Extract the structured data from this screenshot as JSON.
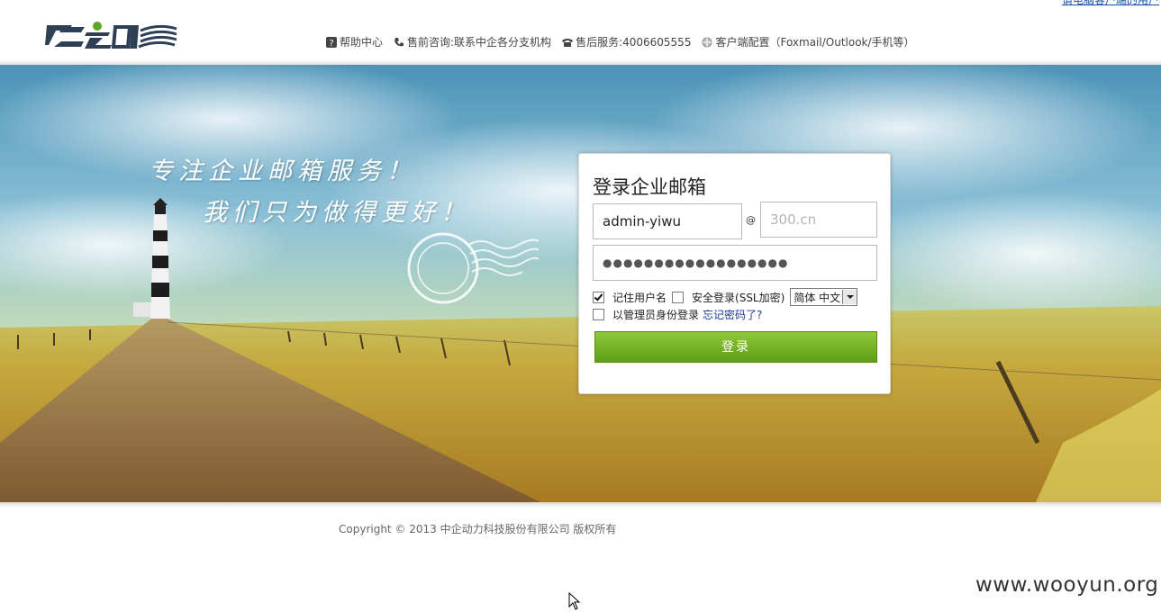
{
  "header": {
    "top_link": "请电脑客户端的用户",
    "logo_alt": "Z云邮",
    "nav": [
      {
        "icon": "question-icon",
        "label": "帮助中心"
      },
      {
        "icon": "phone-icon",
        "label": "售前咨询:联系中企各分支机构"
      },
      {
        "icon": "telephone-icon",
        "label": "售后服务:4006605555"
      },
      {
        "icon": "globe-icon",
        "label": "客户端配置（Foxmail/Outlook/手机等）"
      }
    ]
  },
  "banner": {
    "slogan_line1": "专注企业邮箱服务！",
    "slogan_line2": "我们只为做得更好！"
  },
  "login": {
    "title": "登录企业邮箱",
    "username_value": "admin-yiwu",
    "at_symbol": "@",
    "domain_placeholder": "300.cn",
    "password_mask": "●●●●●●●●●●●●●●●●●●",
    "remember_label": "记住用户名",
    "remember_checked": true,
    "ssl_label": "安全登录(SSL加密)",
    "ssl_checked": false,
    "language_value": "简体 中文",
    "admin_label": "以管理员身份登录",
    "admin_checked": false,
    "forgot_label": "忘记密码了?",
    "submit_label": "登录"
  },
  "footer": {
    "copyright": "Copyright © 2013 中企动力科技股份有限公司 版权所有"
  },
  "watermark": "www.wooyun.org",
  "colors": {
    "accent_green": "#6aaa1f",
    "link_blue": "#1c3a9b"
  }
}
